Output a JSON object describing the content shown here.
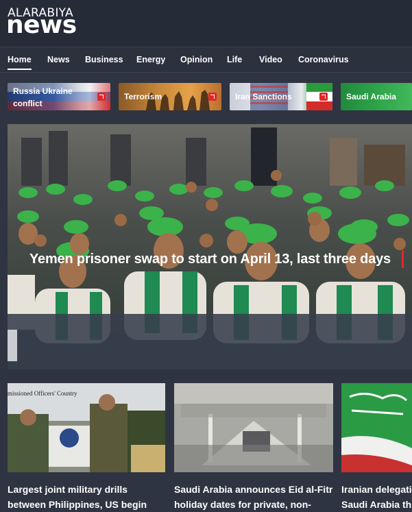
{
  "logo": {
    "top": "ALARABIYA",
    "main": "news"
  },
  "nav": [
    "Home",
    "News",
    "Business",
    "Energy",
    "Opinion",
    "Life",
    "Video",
    "Coronavirus"
  ],
  "topics": [
    {
      "label_line1": "Russia Ukraine",
      "label_line2": "conflict"
    },
    {
      "label_line1": "Terrorism"
    },
    {
      "label_line1": "Iran Sanctions"
    },
    {
      "label_line1": "Saudi Arabia"
    }
  ],
  "hero": {
    "title": "Yemen prisoner swap to start on April 13, last three days"
  },
  "cards": [
    {
      "title_line1": "Largest joint military drills",
      "title_line2": "between Philippines, US begin",
      "banner_text": "missioned Officers' Country"
    },
    {
      "title_line1": "Saudi Arabia announces Eid al-Fitr",
      "title_line2": "holiday dates for private, non-"
    },
    {
      "title_line1": "Iranian delegati",
      "title_line2": "Saudi Arabia thi"
    }
  ],
  "colors": {
    "accent": "#e02828",
    "background": "#2e3441",
    "header": "#252b37"
  }
}
